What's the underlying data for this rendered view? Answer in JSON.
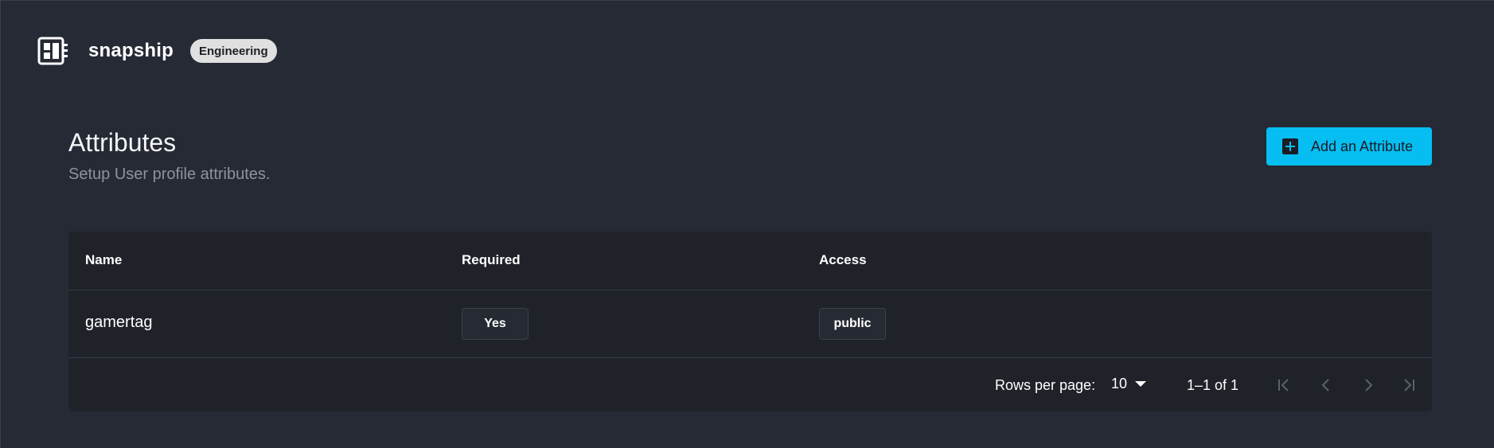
{
  "app": {
    "name": "snapship",
    "workspace_badge": "Engineering",
    "logo_icon": "dashboard-layout-icon"
  },
  "page": {
    "title": "Attributes",
    "subtitle": "Setup User profile attributes.",
    "add_button_label": "Add an Attribute",
    "add_button_icon": "plus-box-icon"
  },
  "table": {
    "columns": [
      "Name",
      "Required",
      "Access"
    ],
    "rows": [
      {
        "name": "gamertag",
        "required": "Yes",
        "access": "public"
      }
    ]
  },
  "pagination": {
    "rows_per_page_label": "Rows per page:",
    "rows_per_page_value": "10",
    "range_text": "1–1 of 1",
    "buttons": [
      "first-page-icon",
      "prev-page-icon",
      "next-page-icon",
      "last-page-icon"
    ]
  },
  "colors": {
    "background": "#252a35",
    "card": "#1f2229",
    "accent": "#06bef2",
    "muted_text": "#8d939d",
    "badge": "#e0e0e0"
  }
}
